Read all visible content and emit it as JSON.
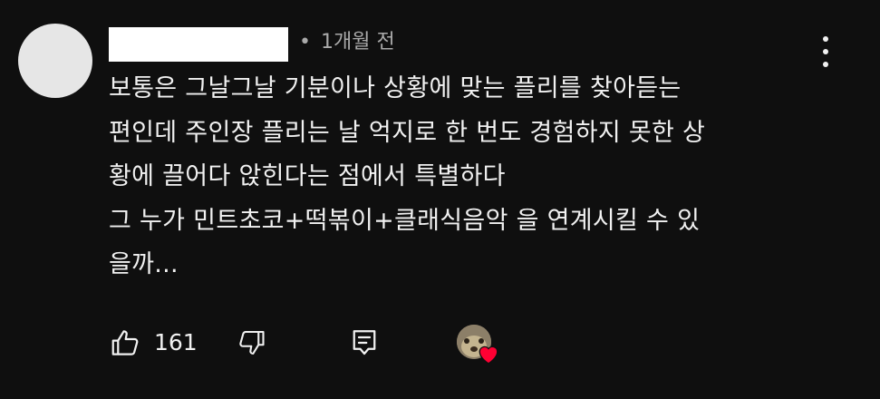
{
  "comment": {
    "time_ago": "1개월 전",
    "meta_separator": "•",
    "lines": [
      "보통은 그날그날 기분이나 상황에 맞는 플리를 찾아듣는",
      "편인데 주인장 플리는 날 억지로 한 번도 경험하지 못한 상",
      "황에 끌어다 앉힌다는 점에서 특별하다",
      "그 누가 민트초코+떡볶이+클래식음악 을 연계시킬 수 있",
      "을까..."
    ]
  },
  "actions": {
    "like_count": "161",
    "icons": {
      "like": "thumbs-up-icon",
      "dislike": "thumbs-down-icon",
      "reply": "reply-icon",
      "menu": "more-vertical-icon",
      "creator_heart": "heart-icon"
    },
    "heart_color": "#ff0033"
  },
  "colors": {
    "background": "#0f0f0f",
    "text": "#f1f1f1",
    "meta": "#aaaaaa"
  }
}
